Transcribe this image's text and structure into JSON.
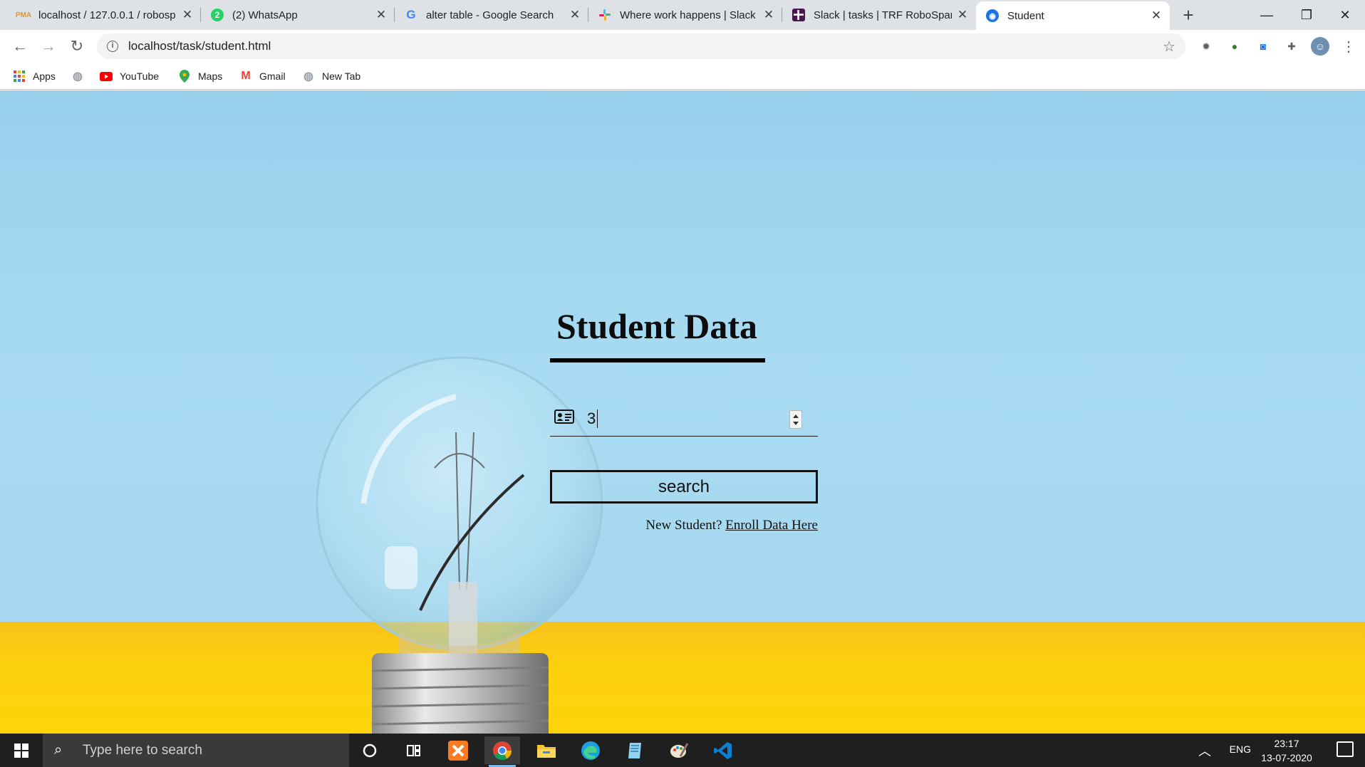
{
  "browser": {
    "tabs": [
      {
        "title": "localhost / 127.0.0.1 / robosp",
        "icon": "phpmyadmin-icon",
        "active": false
      },
      {
        "title": "(2) WhatsApp",
        "icon": "whatsapp-icon",
        "active": false
      },
      {
        "title": "alter table - Google Search",
        "icon": "google-icon",
        "active": false
      },
      {
        "title": "Where work happens | Slack",
        "icon": "slack-icon",
        "active": false
      },
      {
        "title": "Slack | tasks | TRF RoboSpark",
        "icon": "slack-icon",
        "active": false
      },
      {
        "title": "Student",
        "icon": "globe-icon",
        "active": true
      }
    ],
    "url": "localhost/task/student.html",
    "bookmarks": [
      {
        "label": "Apps",
        "icon": "apps-grid-icon"
      },
      {
        "label": "",
        "icon": "globe-icon"
      },
      {
        "label": "YouTube",
        "icon": "youtube-icon"
      },
      {
        "label": "Maps",
        "icon": "maps-icon"
      },
      {
        "label": "Gmail",
        "icon": "gmail-icon"
      },
      {
        "label": "New Tab",
        "icon": "globe-icon"
      }
    ]
  },
  "page": {
    "title": "Student Data",
    "student_id": {
      "value": "3",
      "icon": "id-card-icon"
    },
    "search_label": "search",
    "enroll_prompt": "New Student?",
    "enroll_link": "Enroll Data Here",
    "colors": {
      "sky": "#a5d8ef",
      "floor": "#ffd30a",
      "text": "#111111"
    }
  },
  "taskbar": {
    "search_placeholder": "Type here to search",
    "apps": [
      "cortana-icon",
      "task-view-icon",
      "xampp-icon",
      "chrome-icon",
      "file-explorer-icon",
      "edge-icon",
      "notepad-icon",
      "paint-icon",
      "vscode-icon"
    ],
    "language": "ENG",
    "time": "23:17",
    "date": "13-07-2020"
  }
}
